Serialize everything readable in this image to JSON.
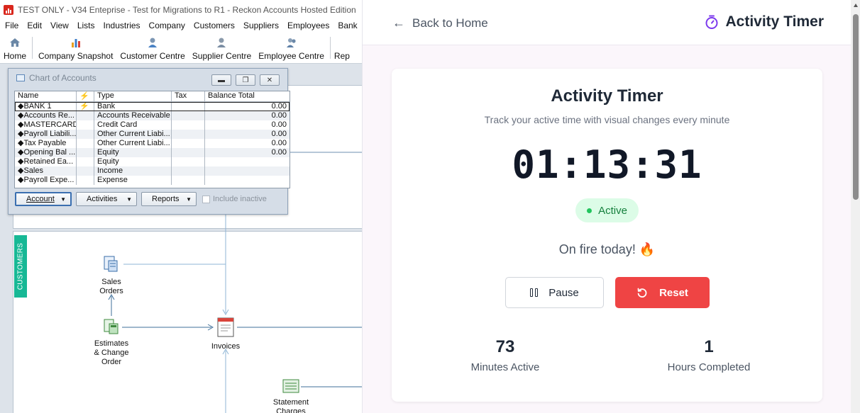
{
  "window": {
    "title": "TEST ONLY - V34 Enteprise - Test for Migrations to R1 - Reckon Accounts Hosted Edition"
  },
  "menu": [
    "File",
    "Edit",
    "View",
    "Lists",
    "Industries",
    "Company",
    "Customers",
    "Suppliers",
    "Employees",
    "Bank"
  ],
  "toolbar": {
    "home": "Home",
    "company_snapshot": "Company Snapshot",
    "customer_centre": "Customer Centre",
    "supplier_centre": "Supplier Centre",
    "employee_centre": "Employee Centre",
    "more": "Rep"
  },
  "coa": {
    "title": "Chart of Accounts",
    "columns": [
      "Name",
      "⚡",
      "Type",
      "Tax",
      "Balance Total"
    ],
    "rows": [
      {
        "name": "◆BANK 1",
        "flag": "⚡",
        "type": "Bank",
        "tax": "",
        "balance": "0.00"
      },
      {
        "name": "◆Accounts Re...",
        "flag": "",
        "type": "Accounts Receivable",
        "tax": "",
        "balance": "0.00"
      },
      {
        "name": "◆MASTERCARD",
        "flag": "",
        "type": "Credit Card",
        "tax": "",
        "balance": "0.00"
      },
      {
        "name": "◆Payroll Liabili...",
        "flag": "",
        "type": "Other Current Liabi...",
        "tax": "",
        "balance": "0.00"
      },
      {
        "name": "◆Tax Payable",
        "flag": "",
        "type": "Other Current Liabi...",
        "tax": "",
        "balance": "0.00"
      },
      {
        "name": "◆Opening Bal ...",
        "flag": "",
        "type": "Equity",
        "tax": "",
        "balance": "0.00"
      },
      {
        "name": "◆Retained Ea...",
        "flag": "",
        "type": "Equity",
        "tax": "",
        "balance": ""
      },
      {
        "name": "◆Sales",
        "flag": "",
        "type": "Income",
        "tax": "",
        "balance": ""
      },
      {
        "name": "◆Payroll Expe...",
        "flag": "",
        "type": "Expense",
        "tax": "",
        "balance": ""
      }
    ],
    "buttons": {
      "account": "Account",
      "activities": "Activities",
      "reports": "Reports"
    },
    "include_inactive": "Include inactive"
  },
  "flow": {
    "tab": "CUSTOMERS",
    "sales_orders": [
      "Sales",
      "Orders"
    ],
    "estimates": [
      "Estimates",
      "& Change",
      "Order"
    ],
    "invoices": "Invoices",
    "statement": [
      "Statement",
      "Charges"
    ]
  },
  "timer": {
    "back_label": "Back to Home",
    "brand_title": "Activity Timer",
    "card_title": "Activity Timer",
    "subtitle": "Track your active time with visual changes every minute",
    "clock": "01:13:31",
    "status": "Active",
    "motto": "On fire today! 🔥",
    "pause_label": "Pause",
    "reset_label": "Reset",
    "stats": [
      {
        "value": "73",
        "label": "Minutes Active"
      },
      {
        "value": "1",
        "label": "Hours Completed"
      }
    ],
    "colors": {
      "accent": "#7c3aed",
      "reset": "#ef4444",
      "active_bg": "#dcfce7",
      "active_text": "#15803d"
    }
  }
}
